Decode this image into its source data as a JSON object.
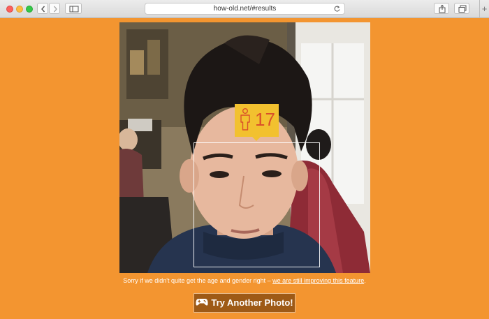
{
  "browser": {
    "url": "how-old.net/#results",
    "new_tab_symbol": "+"
  },
  "photo": {
    "alt": "Photo of a person with detected face",
    "detection": {
      "age": "17",
      "gender_icon": "male-icon"
    }
  },
  "notice": {
    "text": "Sorry if we didn't quite get the age and gender right –",
    "link": "we are still improving this feature",
    "suffix": "."
  },
  "action": {
    "button_label": "Try Another Photo!",
    "button_icon": "gamepad-icon"
  },
  "colors": {
    "background": "#F39530",
    "badge": "#F2C12F",
    "age_text": "#D9502A",
    "button": "#9E5A16"
  }
}
